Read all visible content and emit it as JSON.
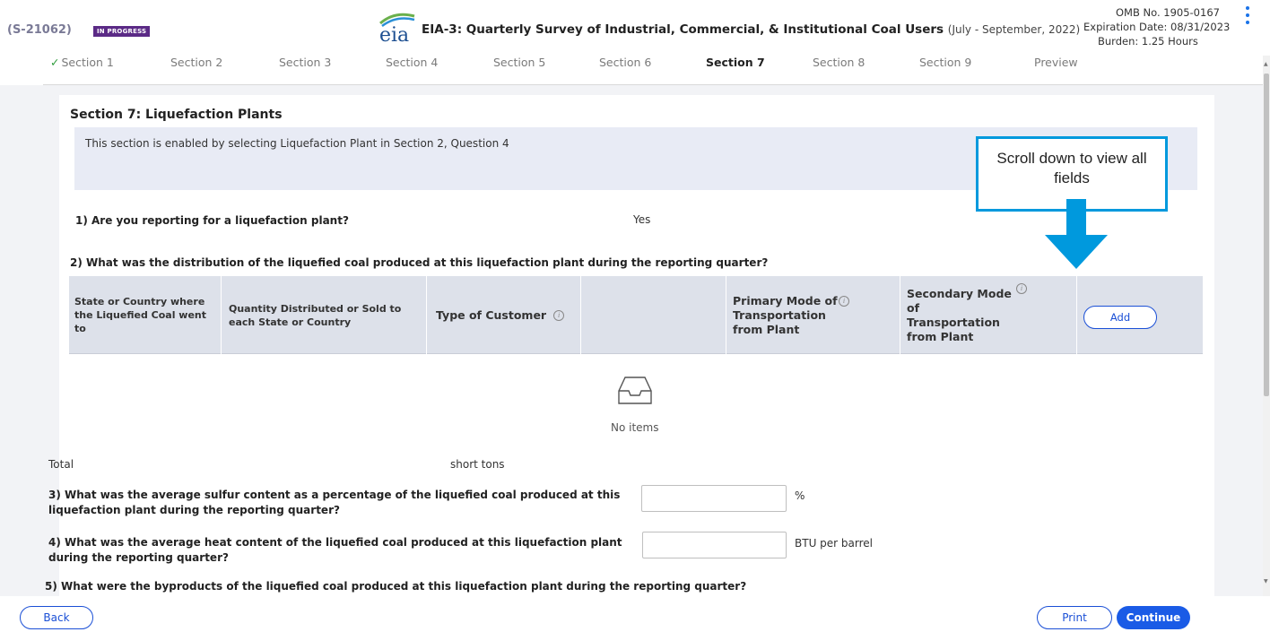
{
  "header": {
    "case_id": "(S-21062)",
    "status": "IN PROGRESS",
    "logo_text": "eia",
    "title": "EIA-3: Quarterly Survey of Industrial, Commercial, & Institutional Coal Users",
    "period": "(July - September, 2022)",
    "omb": "OMB No. 1905-0167",
    "expiration": "Expiration Date: 08/31/2023",
    "burden": "Burden: 1.25 Hours"
  },
  "nav": {
    "items": [
      {
        "label": "Section 1",
        "state": "complete"
      },
      {
        "label": "Section 2",
        "state": "default"
      },
      {
        "label": "Section 3",
        "state": "default"
      },
      {
        "label": "Section 4",
        "state": "default"
      },
      {
        "label": "Section 5",
        "state": "default"
      },
      {
        "label": "Section 6",
        "state": "default"
      },
      {
        "label": "Section 7",
        "state": "active"
      },
      {
        "label": "Section 8",
        "state": "default"
      },
      {
        "label": "Section 9",
        "state": "default"
      },
      {
        "label": "Preview",
        "state": "default"
      }
    ]
  },
  "section": {
    "title": "Section 7: Liquefaction Plants",
    "info": "This section is enabled by selecting Liquefaction Plant in Section 2, Question 4"
  },
  "q1": {
    "text": "1) Are you reporting for a liquefaction plant?",
    "answer": "Yes"
  },
  "q2": {
    "text": "2) What was the distribution of the liquefied coal produced at this liquefaction plant during the reporting quarter?",
    "columns": [
      "State or Country where the Liquefied Coal went to",
      "Quantity Distributed or Sold to each State or Country",
      "Type of Customer",
      "",
      "Primary Mode of Transportation from Plant",
      "Secondary Mode of Transportation from Plant"
    ],
    "add_label": "Add",
    "empty_text": "No items",
    "total_label": "Total",
    "total_unit": "short tons"
  },
  "q3": {
    "text": "3) What was the average sulfur content as a percentage of the liquefied coal produced at this liquefaction plant during the reporting quarter?",
    "value": "",
    "unit": "%"
  },
  "q4": {
    "text": "4) What was the average heat content of the liquefied coal produced at this liquefaction plant during the reporting quarter?",
    "value": "",
    "unit": "BTU per barrel"
  },
  "q5": {
    "text": "5) What were the byproducts of the liquefied coal produced at this liquefaction plant during the reporting quarter?"
  },
  "callout": {
    "text": "Scroll down to view all fields"
  },
  "footer": {
    "back": "Back",
    "print": "Print",
    "continue": "Continue"
  },
  "colors": {
    "accent": "#1a5be6",
    "callout": "#0099dd",
    "status_badge": "#5b2a86",
    "complete_check": "#2e9c3b"
  }
}
